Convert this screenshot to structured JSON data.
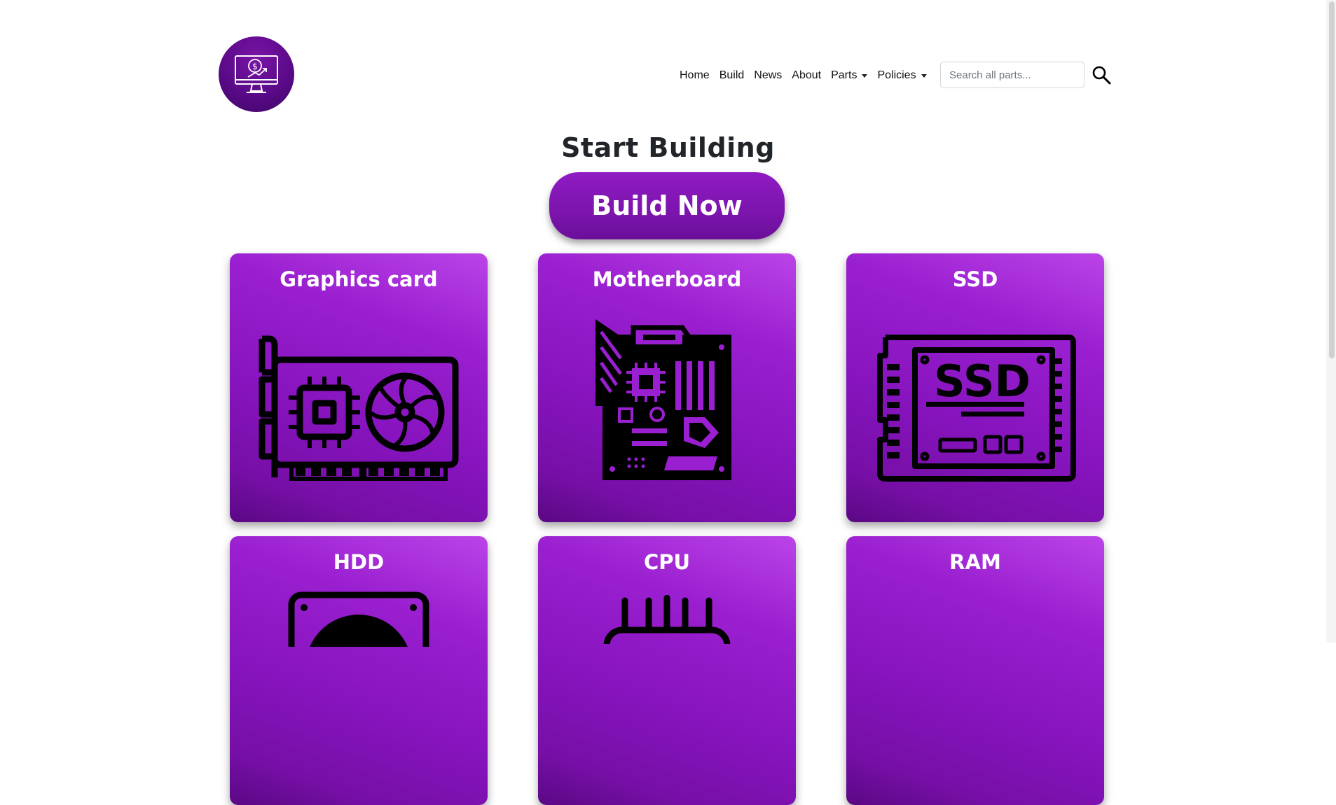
{
  "nav": {
    "items": [
      "Home",
      "Build",
      "News",
      "About"
    ],
    "parts_label": "Parts",
    "policies_label": "Policies"
  },
  "search": {
    "placeholder": "Search all parts..."
  },
  "hero": {
    "title": "Start Building",
    "button_label": "Build Now"
  },
  "cards": [
    {
      "label": "Graphics card",
      "icon": "graphics-card-icon"
    },
    {
      "label": "Motherboard",
      "icon": "motherboard-icon"
    },
    {
      "label": "SSD",
      "icon": "ssd-icon",
      "icon_text": "SSD"
    },
    {
      "label": "HDD",
      "icon": "hdd-icon"
    },
    {
      "label": "CPU",
      "icon": "cpu-icon"
    },
    {
      "label": "RAM",
      "icon": "ram-icon"
    }
  ],
  "colors": {
    "brand_purple": "#8714be",
    "card_highlight": "#bb44e8",
    "logo_purple": "#5a0a88"
  }
}
